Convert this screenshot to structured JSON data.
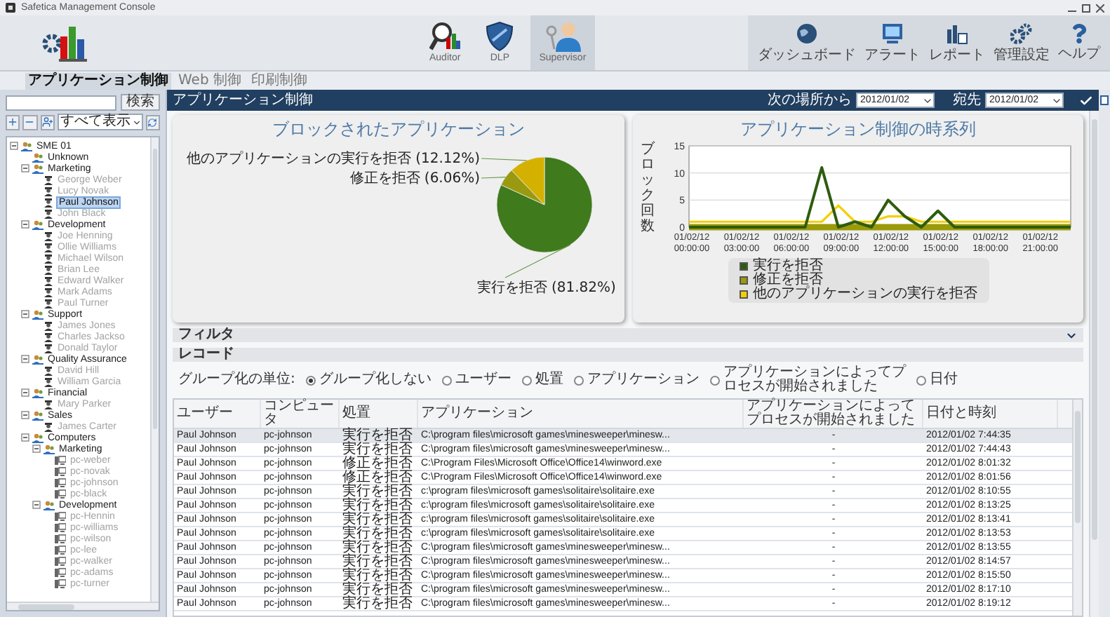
{
  "window": {
    "title": "Safetica Management Console"
  },
  "toolbar": {
    "modules": [
      {
        "label": "Auditor",
        "kind": "auditor",
        "selected": false
      },
      {
        "label": "DLP",
        "kind": "dlp",
        "selected": false
      },
      {
        "label": "Supervisor",
        "kind": "supervisor",
        "selected": true
      }
    ],
    "tools": [
      {
        "label": "ダッシュボード",
        "kind": "dashboard"
      },
      {
        "label": "アラート",
        "kind": "alert"
      },
      {
        "label": "レポート",
        "kind": "report"
      },
      {
        "label": "管理設定",
        "kind": "settings"
      },
      {
        "label": "ヘルプ",
        "kind": "help"
      }
    ]
  },
  "tabs": [
    {
      "label": "アプリケーション制御",
      "selected": true
    },
    {
      "label": "Web 制御",
      "selected": false
    },
    {
      "label": "印刷制御",
      "selected": false
    }
  ],
  "sidebar": {
    "search_button": "検索",
    "view_select": "すべて表示",
    "tree": [
      {
        "label": "SME 01",
        "kind": "root",
        "expanded": true,
        "selected": false,
        "children": [
          {
            "label": "Unknown",
            "kind": "group",
            "selected": false
          },
          {
            "label": "Marketing",
            "kind": "group",
            "expanded": true,
            "selected": false,
            "children": [
              {
                "label": "George Weber",
                "kind": "user",
                "online": false,
                "selected": false
              },
              {
                "label": "Lucy Novak",
                "kind": "user",
                "online": false,
                "selected": false
              },
              {
                "label": "Paul Johnson",
                "kind": "user",
                "online": false,
                "selected": true
              },
              {
                "label": "John Black",
                "kind": "user",
                "online": false,
                "selected": false
              }
            ]
          },
          {
            "label": "Development",
            "kind": "group",
            "expanded": true,
            "selected": false,
            "children": [
              {
                "label": "Joe Henning",
                "kind": "user",
                "online": false,
                "selected": false
              },
              {
                "label": "Ollie Williams",
                "kind": "user",
                "online": false,
                "selected": false
              },
              {
                "label": "Michael Wilson",
                "kind": "user",
                "online": false,
                "selected": false
              },
              {
                "label": "Brian Lee",
                "kind": "user",
                "online": false,
                "selected": false
              },
              {
                "label": "Edward Walker",
                "kind": "user",
                "online": false,
                "selected": false
              },
              {
                "label": "Mark Adams",
                "kind": "user",
                "online": false,
                "selected": false
              },
              {
                "label": "Paul Turner",
                "kind": "user",
                "online": false,
                "selected": false
              }
            ]
          },
          {
            "label": "Support",
            "kind": "group",
            "expanded": true,
            "selected": false,
            "children": [
              {
                "label": "James Jones",
                "kind": "user",
                "online": false,
                "selected": false
              },
              {
                "label": "Charles Jackso",
                "kind": "user",
                "online": false,
                "selected": false
              },
              {
                "label": "Donald Taylor",
                "kind": "user",
                "online": false,
                "selected": false
              }
            ]
          },
          {
            "label": "Quality Assurance",
            "kind": "group",
            "expanded": true,
            "selected": false,
            "children": [
              {
                "label": "David Hill",
                "kind": "user",
                "online": false,
                "selected": false
              },
              {
                "label": "William Garcia",
                "kind": "user",
                "online": false,
                "selected": false
              }
            ]
          },
          {
            "label": "Financial",
            "kind": "group",
            "expanded": true,
            "selected": false,
            "children": [
              {
                "label": "Mary Parker",
                "kind": "user",
                "online": false,
                "selected": false
              }
            ]
          },
          {
            "label": "Sales",
            "kind": "group",
            "expanded": true,
            "selected": false,
            "children": [
              {
                "label": "James Carter",
                "kind": "user",
                "online": false,
                "selected": false
              }
            ]
          },
          {
            "label": "Computers",
            "kind": "group",
            "expanded": true,
            "selected": false,
            "children": [
              {
                "label": "Marketing",
                "kind": "group",
                "expanded": true,
                "selected": false,
                "children": [
                  {
                    "label": "pc-weber",
                    "kind": "computer",
                    "online": false,
                    "selected": false
                  },
                  {
                    "label": "pc-novak",
                    "kind": "computer",
                    "online": false,
                    "selected": false
                  },
                  {
                    "label": "pc-johnson",
                    "kind": "computer",
                    "online": false,
                    "selected": false
                  },
                  {
                    "label": "pc-black",
                    "kind": "computer",
                    "online": false,
                    "selected": false
                  }
                ]
              },
              {
                "label": "Development",
                "kind": "group",
                "expanded": true,
                "selected": false,
                "children": [
                  {
                    "label": "pc-Hennin",
                    "kind": "computer",
                    "online": false,
                    "selected": false
                  },
                  {
                    "label": "pc-williams",
                    "kind": "computer",
                    "online": false,
                    "selected": false
                  },
                  {
                    "label": "pc-wilson",
                    "kind": "computer",
                    "online": false,
                    "selected": false
                  },
                  {
                    "label": "pc-lee",
                    "kind": "computer",
                    "online": false,
                    "selected": false
                  },
                  {
                    "label": "pc-walker",
                    "kind": "computer",
                    "online": false,
                    "selected": false
                  },
                  {
                    "label": "pc-adams",
                    "kind": "computer",
                    "online": false,
                    "selected": false
                  },
                  {
                    "label": "pc-turner",
                    "kind": "computer",
                    "online": false,
                    "selected": false
                  }
                ]
              }
            ]
          }
        ]
      }
    ]
  },
  "header": {
    "title": "アプリケーション制御",
    "from_label": "次の場所から",
    "from_value": "2012/01/02",
    "to_label": "宛先",
    "to_value": "2012/01/02"
  },
  "pie_card": {
    "title": "ブロックされたアプリケーション",
    "chart_data": {
      "type": "pie",
      "categories": [
        "実行を拒否",
        "修正を拒否",
        "他のアプリケーションの実行を拒否"
      ],
      "values": [
        81.82,
        6.06,
        12.12
      ],
      "data_labels": true,
      "value_labels": [
        "(81.82%)",
        "(6.06%)",
        "(12.12%)"
      ]
    }
  },
  "line_card": {
    "title": "アプリケーション制御の時系列",
    "chart_data": {
      "type": "line",
      "ylabel": "ブロック回数",
      "categories": [
        "01/02/12 00:00:00",
        null,
        null,
        "01/02/12 03:00:00",
        null,
        null,
        "01/02/12 06:00:00",
        null,
        null,
        "01/02/12 09:00:00",
        null,
        null,
        "01/02/12 12:00:00",
        null,
        null,
        "01/02/12 15:00:00",
        null,
        null,
        "01/02/12 18:00:00",
        null,
        null,
        "01/02/12 21:00:00",
        null,
        null
      ],
      "series": [
        {
          "name": "実行を拒否",
          "color": "#2e5c0e",
          "values": [
            0,
            0,
            0,
            0,
            0,
            0,
            0,
            0,
            11,
            0,
            1,
            0,
            5,
            2,
            0,
            3,
            0,
            0,
            0,
            0,
            0,
            0,
            0,
            0
          ]
        },
        {
          "name": "修正を拒否",
          "color": "#9a9a0a",
          "values": [
            0,
            0,
            0,
            0,
            0,
            0,
            0,
            0,
            0,
            0,
            0,
            0,
            0,
            0,
            0,
            0,
            0,
            0,
            0,
            0,
            0,
            0,
            0,
            0
          ]
        },
        {
          "name": "他のアプリケーションの実行を拒否",
          "color": "#f2d000",
          "values": [
            1,
            1,
            1,
            1,
            1,
            1,
            1,
            1,
            1,
            4,
            1,
            1,
            2,
            2,
            1,
            1,
            1,
            1,
            1,
            1,
            1,
            1,
            1,
            1
          ]
        }
      ],
      "ylim": [
        0,
        15
      ],
      "yticks": [
        0,
        5,
        10,
        15
      ]
    }
  },
  "filter": {
    "title": "フィルタ",
    "expanded": false
  },
  "records": {
    "title": "レコード",
    "group_label": "グループ化の単位:",
    "group_options": [
      {
        "label": "グループ化しない",
        "selected": true
      },
      {
        "label": "ユーザー",
        "selected": false
      },
      {
        "label": "処置",
        "selected": false
      },
      {
        "label": "アプリケーション",
        "selected": false
      },
      {
        "label": "アプリケーションによってプロセスが開始されました",
        "selected": false
      },
      {
        "label": "日付",
        "selected": false
      }
    ],
    "table": {
      "columns": [
        "ユーザー",
        "コンピュータ",
        "処置",
        "アプリケーション",
        "アプリケーションによってプロセスが開始されました",
        "日付と時刻"
      ],
      "rows": [
        {
          "selected": true,
          "cells": [
            "Paul Johnson",
            "pc-johnson",
            "実行を拒否",
            "C:\\program files\\microsoft games\\minesweeper\\minesw...",
            "-",
            "2012/01/02 7:44:35"
          ]
        },
        {
          "selected": false,
          "cells": [
            "Paul Johnson",
            "pc-johnson",
            "実行を拒否",
            "C:\\program files\\microsoft games\\minesweeper\\minesw...",
            "-",
            "2012/01/02 7:44:43"
          ]
        },
        {
          "selected": false,
          "cells": [
            "Paul Johnson",
            "pc-johnson",
            "修正を拒否",
            "C:\\Program Files\\Microsoft Office\\Office14\\winword.exe",
            "-",
            "2012/01/02 8:01:32"
          ]
        },
        {
          "selected": false,
          "cells": [
            "Paul Johnson",
            "pc-johnson",
            "修正を拒否",
            "C:\\Program Files\\Microsoft Office\\Office14\\winword.exe",
            "-",
            "2012/01/02 8:01:56"
          ]
        },
        {
          "selected": false,
          "cells": [
            "Paul Johnson",
            "pc-johnson",
            "実行を拒否",
            "c:\\program files\\microsoft games\\solitaire\\solitaire.exe",
            "-",
            "2012/01/02 8:10:55"
          ]
        },
        {
          "selected": false,
          "cells": [
            "Paul Johnson",
            "pc-johnson",
            "実行を拒否",
            "c:\\program files\\microsoft games\\solitaire\\solitaire.exe",
            "-",
            "2012/01/02 8:13:25"
          ]
        },
        {
          "selected": false,
          "cells": [
            "Paul Johnson",
            "pc-johnson",
            "実行を拒否",
            "c:\\program files\\microsoft games\\solitaire\\solitaire.exe",
            "-",
            "2012/01/02 8:13:41"
          ]
        },
        {
          "selected": false,
          "cells": [
            "Paul Johnson",
            "pc-johnson",
            "実行を拒否",
            "c:\\program files\\microsoft games\\solitaire\\solitaire.exe",
            "-",
            "2012/01/02 8:13:53"
          ]
        },
        {
          "selected": false,
          "cells": [
            "Paul Johnson",
            "pc-johnson",
            "実行を拒否",
            "C:\\program files\\microsoft games\\minesweeper\\minesw...",
            "-",
            "2012/01/02 8:13:55"
          ]
        },
        {
          "selected": false,
          "cells": [
            "Paul Johnson",
            "pc-johnson",
            "実行を拒否",
            "C:\\program files\\microsoft games\\minesweeper\\minesw...",
            "-",
            "2012/01/02 8:14:57"
          ]
        },
        {
          "selected": false,
          "cells": [
            "Paul Johnson",
            "pc-johnson",
            "実行を拒否",
            "C:\\program files\\microsoft games\\minesweeper\\minesw...",
            "-",
            "2012/01/02 8:15:50"
          ]
        },
        {
          "selected": false,
          "cells": [
            "Paul Johnson",
            "pc-johnson",
            "実行を拒否",
            "C:\\program files\\microsoft games\\minesweeper\\minesw...",
            "-",
            "2012/01/02 8:17:10"
          ]
        },
        {
          "selected": false,
          "cells": [
            "Paul Johnson",
            "pc-johnson",
            "実行を拒否",
            "C:\\program files\\microsoft games\\minesweeper\\minesw...",
            "-",
            "2012/01/02 8:19:12"
          ]
        }
      ]
    }
  }
}
